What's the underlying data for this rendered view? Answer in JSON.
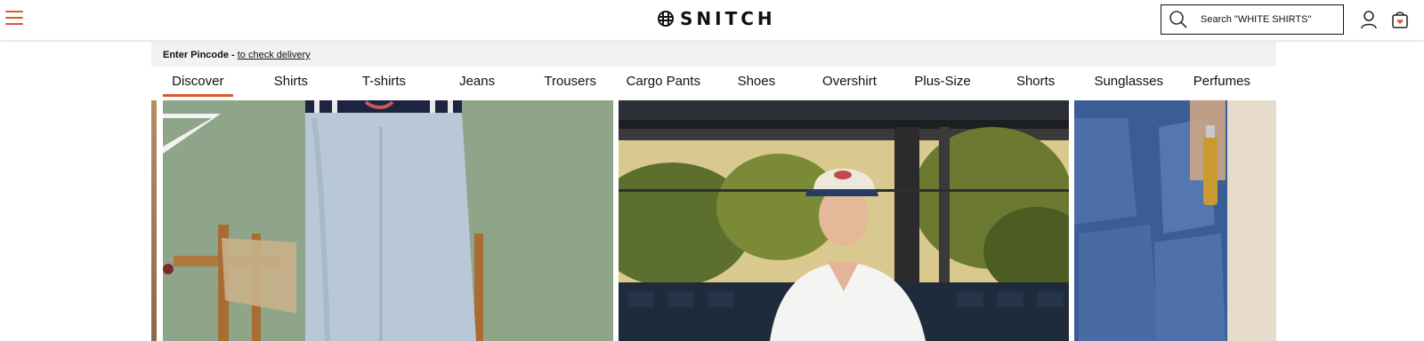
{
  "header": {
    "brand": "SNITCH",
    "search_placeholder": "Search \"WHITE SHIRTS\"",
    "icons": {
      "menu": "hamburger-menu-icon",
      "logo": "snitch-logo-mark",
      "search": "search-icon",
      "account": "user-icon",
      "cart": "shopping-bag-icon"
    },
    "accent_color": "#e0532f"
  },
  "pincode": {
    "label": "Enter Pincode -",
    "link": "to check delivery"
  },
  "categories": [
    {
      "label": "Discover",
      "active": true
    },
    {
      "label": "Shirts"
    },
    {
      "label": "T-shirts"
    },
    {
      "label": "Jeans"
    },
    {
      "label": "Trousers"
    },
    {
      "label": "Cargo Pants"
    },
    {
      "label": "Shoes"
    },
    {
      "label": "Overshirt"
    },
    {
      "label": "Plus-Size"
    },
    {
      "label": "Shorts"
    },
    {
      "label": "Sunglasses"
    },
    {
      "label": "Perfumes"
    }
  ]
}
